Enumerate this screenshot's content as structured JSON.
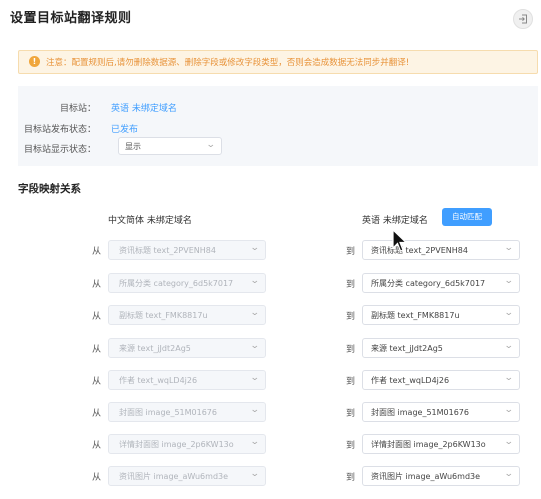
{
  "header": {
    "title": "设置目标站翻译规则",
    "exit_icon": "exit-icon"
  },
  "notice": {
    "icon": "warning-icon",
    "icon_glyph": "!",
    "text": "注意：配置规则后,请勿删除数据源、删除字段或修改字段类型，否则会造成数据无法同步并翻译!"
  },
  "info": {
    "target_site_label": "目标站：",
    "target_site_value": "英语 未绑定域名",
    "publish_status_label": "目标站发布状态：",
    "publish_status_value": "已发布",
    "display_status_label": "目标站显示状态：",
    "display_status_value": "显示"
  },
  "mapping": {
    "section_title": "字段映射关系",
    "source_header": "中文简体 未绑定域名",
    "target_header": "英语 未绑定域名",
    "auto_match_label": "自动匹配",
    "from_label": "从",
    "to_label": "到",
    "rows": [
      {
        "source": "资讯标题 text_2PVENH84",
        "target": "资讯标题 text_2PVENH84"
      },
      {
        "source": "所属分类 category_6d5k7017",
        "target": "所属分类 category_6d5k7017"
      },
      {
        "source": "副标题 text_FMK8817u",
        "target": "副标题 text_FMK8817u"
      },
      {
        "source": "来源 text_jJdt2Ag5",
        "target": "来源 text_jJdt2Ag5"
      },
      {
        "source": "作者 text_wqLD4j26",
        "target": "作者 text_wqLD4j26"
      },
      {
        "source": "封面图 image_51M01676",
        "target": "封面图 image_51M01676"
      },
      {
        "source": "详情封面图 image_2p6KW13o",
        "target": "详情封面图 image_2p6KW13o"
      },
      {
        "source": "资讯图片 image_aWu6md3e",
        "target": "资讯图片 image_aWu6md3e"
      }
    ]
  },
  "colors": {
    "accent": "#409eff",
    "warning": "#e8933a",
    "warning_bg": "#fdf4e4"
  }
}
